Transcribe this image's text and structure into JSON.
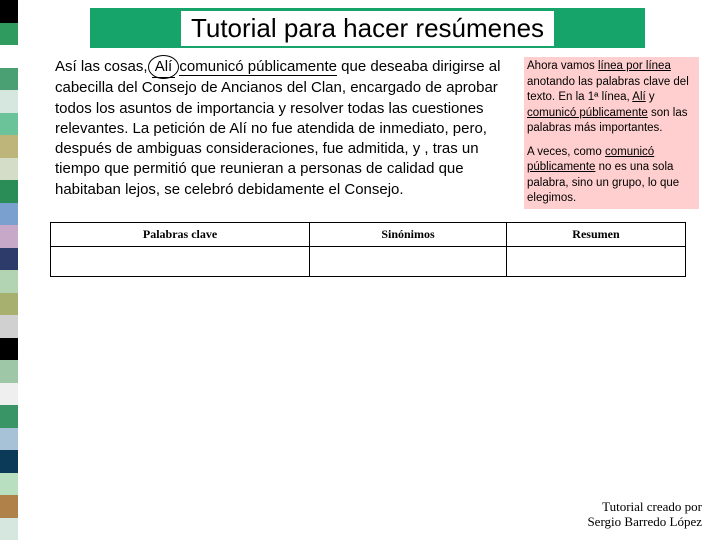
{
  "title": "Tutorial para hacer resúmenes",
  "main": {
    "pre": "Así las cosas, ",
    "kw1": "Alí",
    "mid1": " ",
    "kw2": "comunicó públicamente",
    "rest": " que deseaba dirigirse al cabecilla del Consejo de Ancianos del Clan, encargado de aprobar todos los asuntos de importancia y resolver todas las cuestiones relevantes. La petición de Alí no fue atendida de inmediato, pero, después de ambiguas consideraciones, fue admitida, y , tras un tiempo que permitió que reunieran a personas de calidad que habitaban lejos, se celebró debidamente el Consejo."
  },
  "side": {
    "p1a": "Ahora vamos ",
    "p1u1": "línea por línea",
    "p1b": " anotando las palabras clave del texto. En la 1ª línea, ",
    "p1u2": "Alí",
    "p1c": " y ",
    "p1u3": "comunicó públicamente",
    "p1d": " son las palabras más importantes.",
    "p2a": "A veces, como ",
    "p2u1": "comunicó públicamente",
    "p2b": " no es una sola palabra, sino un grupo, lo que elegimos."
  },
  "table": {
    "h1": "Palabras clave",
    "h2": "Sinónimos",
    "h3": "Resumen"
  },
  "footer": {
    "l1": "Tutorial creado por",
    "l2": "Sergio Barredo López"
  }
}
